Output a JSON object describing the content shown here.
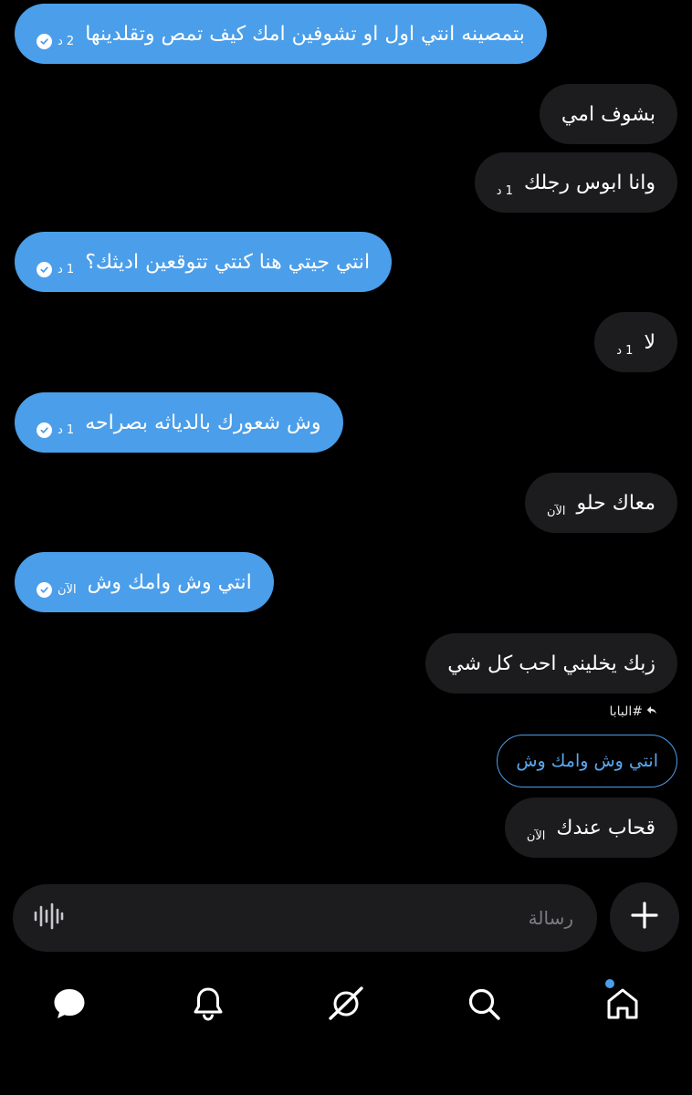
{
  "messages": [
    {
      "text": "بتمصينه انتي اول او تشوفين امك كيف تمص وتقلدينها",
      "time": "2 د",
      "dir": "out"
    },
    {
      "text": "بشوف امي",
      "time": "",
      "dir": "in"
    },
    {
      "text": "وانا ابوس رجلك",
      "time": "1 د",
      "dir": "in"
    },
    {
      "text": "انتي جيتي هنا كنتي تتوقعين اديثك؟",
      "time": "1 د",
      "dir": "out"
    },
    {
      "text": "لا",
      "time": "1 د",
      "dir": "in"
    },
    {
      "text": "وش شعورك بالدياثه بصراحه",
      "time": "1 د",
      "dir": "out"
    },
    {
      "text": "معاك حلو",
      "time": "الآن",
      "dir": "in"
    },
    {
      "text": "انتي وش وامك وش",
      "time": "الآن",
      "dir": "out"
    },
    {
      "text": "زبك يخليني احب كل شي",
      "time": "",
      "dir": "in"
    },
    {
      "text": "قحاب عندك",
      "time": "الآن",
      "dir": "in"
    }
  ],
  "reply": {
    "label": "#البابا",
    "quoted_text": "انتي وش وامك وش"
  },
  "composer": {
    "placeholder": "رسالة"
  },
  "nav": [
    "messages-icon",
    "bell-icon",
    "grok-icon",
    "search-icon",
    "home-icon"
  ],
  "colors": {
    "outgoing": "#4b9ee9",
    "incoming": "#1c1c1e",
    "background": "#000000"
  }
}
